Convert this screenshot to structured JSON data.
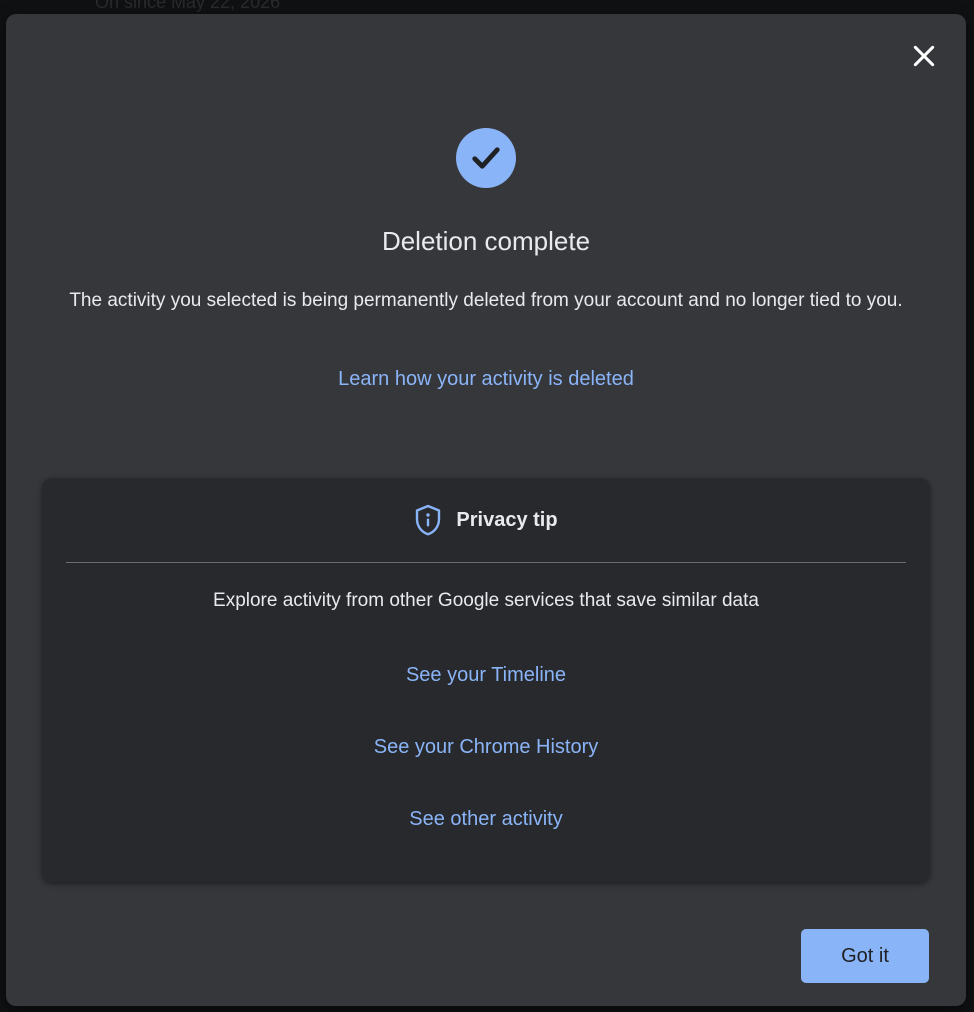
{
  "background": {
    "behind_text": "On since May 22, 2026"
  },
  "dialog": {
    "close_icon": "close-icon",
    "success_icon": "check-circle-icon",
    "title": "Deletion complete",
    "description": "The activity you selected is being permanently deleted from your account and no longer tied to you.",
    "learn_link": "Learn how your activity is deleted",
    "privacy_tip": {
      "icon": "shield-info-icon",
      "title": "Privacy tip",
      "text": "Explore activity from other Google services that save similar data",
      "links": [
        "See your Timeline",
        "See your Chrome History",
        "See other activity"
      ]
    },
    "confirm_label": "Got it"
  },
  "colors": {
    "dialog_bg": "#36373b",
    "card_bg": "#28292c",
    "accent": "#8ab4f8",
    "text": "#e8eaed"
  }
}
